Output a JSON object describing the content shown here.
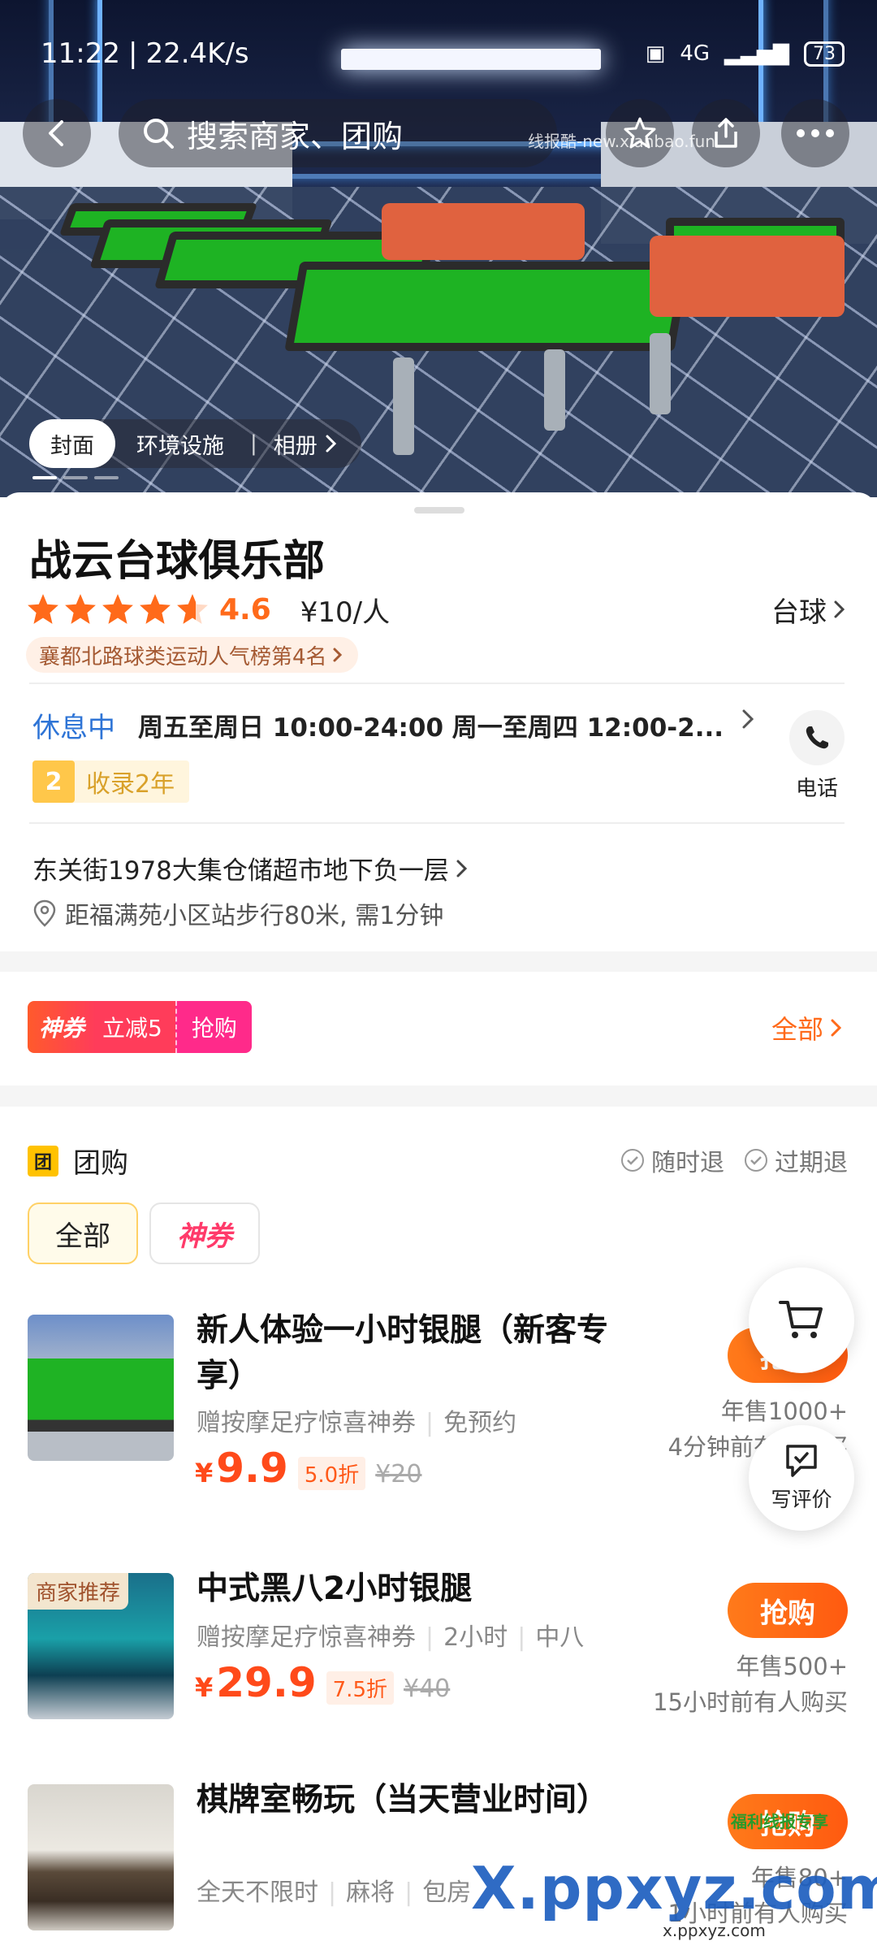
{
  "status_bar": {
    "time": "11:22",
    "network_speed": "22.4K/s",
    "network_type": "4G",
    "battery": "73"
  },
  "top_bar": {
    "search_placeholder": "搜索商家、团购",
    "watermark": "线报酷-new.xianbao.fun"
  },
  "hero": {
    "tabs": [
      "封面",
      "环境设施"
    ],
    "album_label": "相册"
  },
  "shop": {
    "name": "战云台球俱乐部",
    "rating": 4.6,
    "rating_text": "4.6",
    "price": "¥10/人",
    "category": "台球",
    "rank_badge": "襄都北路球类运动人气榜第4名",
    "status": "休息中",
    "hours": "周五至周日 10:00-24:00  周一至周四 12:00-2...",
    "years_num": "2",
    "years_text": "收录2年",
    "phone_label": "电话",
    "address": "东关街1978大集仓储超市地下负一层",
    "distance": "距福满苑小区站步行80米, 需1分钟"
  },
  "coupon": {
    "tag": "神券",
    "discount": "立减5",
    "action": "抢购",
    "all_label": "全部"
  },
  "group_buy": {
    "title": "团购",
    "icon_text": "团",
    "policies": [
      "随时退",
      "过期退"
    ],
    "filters": [
      "全部",
      "神券"
    ],
    "deals": [
      {
        "title": "新人体验一小时银腿（新客专享）",
        "tags": [
          "赠按摩足疗惊喜神券",
          "免预约"
        ],
        "price": "9.9",
        "discount": "5.0折",
        "original": "¥20",
        "sold": "年售1000+",
        "recent": "4分钟前有人购买",
        "button": "抢购"
      },
      {
        "badge": "商家推荐",
        "title": "中式黑八2小时银腿",
        "tags": [
          "赠按摩足疗惊喜神券",
          "2小时",
          "中八"
        ],
        "price": "29.9",
        "discount": "7.5折",
        "original": "¥40",
        "sold": "年售500+",
        "recent": "15小时前有人购买",
        "button": "抢购"
      },
      {
        "title": "棋牌室畅玩（当天营业时间）",
        "tags": [
          "全天不限时",
          "麻将",
          "包房"
        ],
        "sold": "年售80+",
        "recent": "1小时前有人购买",
        "button": "抢购"
      }
    ]
  },
  "floating": {
    "review_label": "写评价"
  },
  "watermark_bottom": {
    "main_a": "X.",
    "main_b": "ppxyz.com",
    "small": "x.ppxyz.com",
    "badge": "福利线报专享"
  },
  "colors": {
    "accent": "#ff6a1a",
    "status_blue": "#2e74d6",
    "coupon_pink": "#ff2a8a"
  }
}
